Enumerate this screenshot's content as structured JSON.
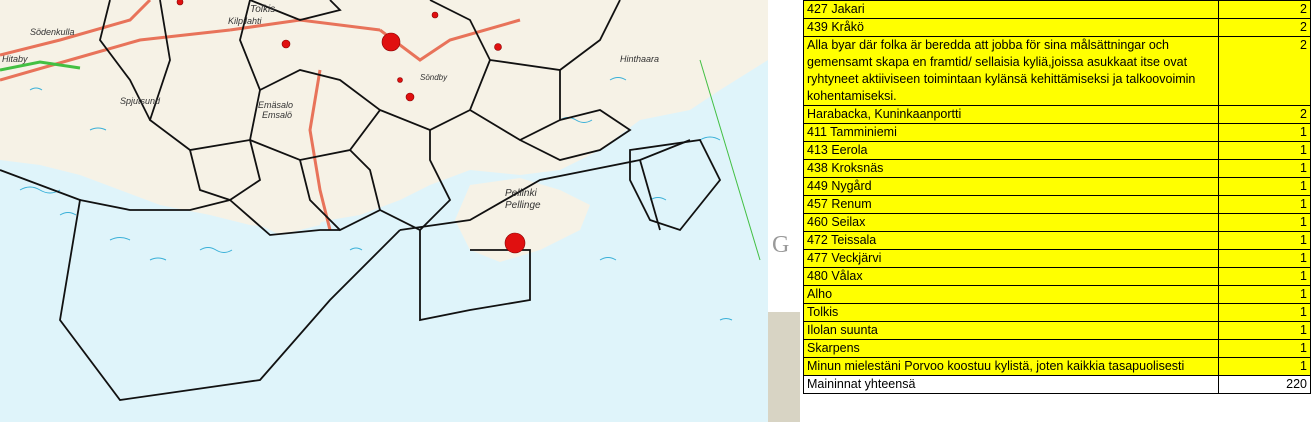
{
  "map": {
    "labels": {
      "sodenkulla": "Södenkulla",
      "tolkis": "Tolkis",
      "kilpilahti": "Kilpilahti",
      "sköldvik": "Sköldvik",
      "sondby": "Söndby",
      "spjutsund": "Spjutsund",
      "emasalo": "Emäsalo",
      "emsalo": "Emsalö",
      "pellinki": "Pellinki",
      "pellinge": "Pellinge",
      "hinthaara": "Hinthaara",
      "hitaby": "Hitaby"
    }
  },
  "slide": {
    "partial_text": "G"
  },
  "table": {
    "rows": [
      {
        "name": "427 Jakari",
        "count": "2"
      },
      {
        "name": "439 Kråkö",
        "count": "2"
      },
      {
        "name": "Alla byar där folka är beredda att jobba för sina målsättningar och gemensamt skapa en framtid/   sellaisia kyliä,joissa asukkaat itse ovat ryhtyneet aktiiviseen toimintaan kylänsä kehittämiseksi ja talkoovoimin kohentamiseksi.",
        "count": "2"
      },
      {
        "name": "Harabacka, Kuninkaanportti",
        "count": "2"
      },
      {
        "name": "411 Tamminiemi",
        "count": "1"
      },
      {
        "name": "413 Eerola",
        "count": "1"
      },
      {
        "name": "438 Kroksnäs",
        "count": "1"
      },
      {
        "name": "449 Nygård",
        "count": "1"
      },
      {
        "name": "457 Renum",
        "count": "1"
      },
      {
        "name": "460 Seilax",
        "count": "1"
      },
      {
        "name": "472 Teissala",
        "count": "1"
      },
      {
        "name": "477 Veckjärvi",
        "count": "1"
      },
      {
        "name": "480 Vålax",
        "count": "1"
      },
      {
        "name": "Alho",
        "count": "1"
      },
      {
        "name": "Tolkis",
        "count": "1"
      },
      {
        "name": "Ilolan suunta",
        "count": "1"
      },
      {
        "name": "Skarpens",
        "count": "1"
      },
      {
        "name": "Minun mielestäni Porvoo koostuu kylistä, joten kaikkia tasapuolisesti",
        "count": "1"
      }
    ],
    "total": {
      "name": "Maininnat yhteensä",
      "count": "220"
    }
  },
  "colors": {
    "sea": "#dff4fa",
    "land": "#f6f2e6",
    "highlight": "#ffff00",
    "boundary": "#111111",
    "road": "#e8735a",
    "marker": "#e01010"
  }
}
